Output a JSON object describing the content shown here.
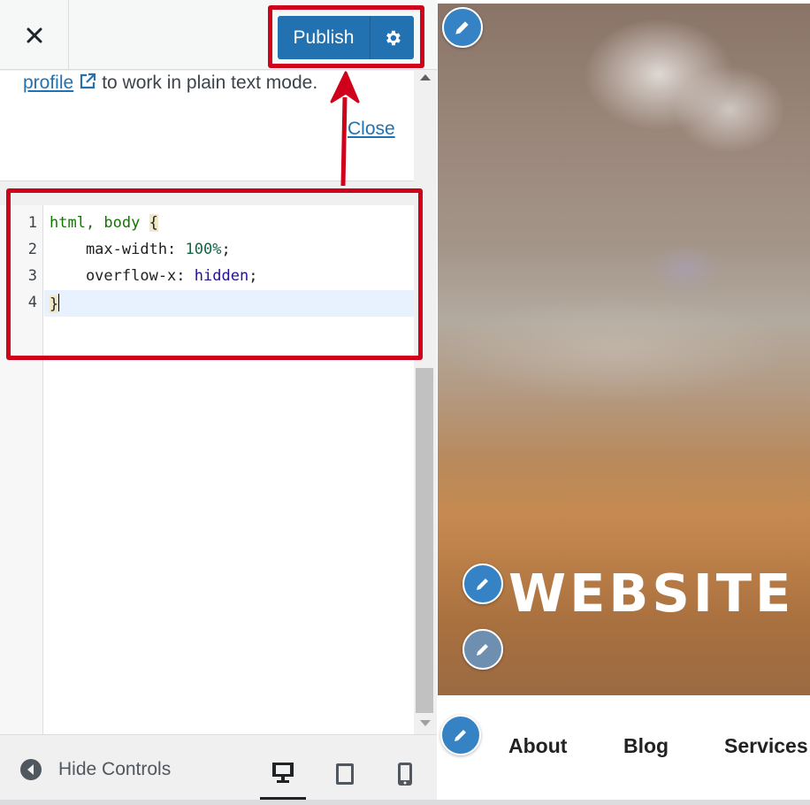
{
  "header": {
    "publish_label": "Publish"
  },
  "notice": {
    "link_text": "profile",
    "text_after": "to work in plain text mode.",
    "close_link": "Close"
  },
  "editor": {
    "line_numbers": [
      "1",
      "2",
      "3",
      "4"
    ],
    "line1": {
      "selector": "html, body",
      "brace": "{"
    },
    "line2": {
      "property": "    max-width: ",
      "value": "100%",
      "end": ";"
    },
    "line3": {
      "property": "    overflow-x: ",
      "value": "hidden",
      "end": ";"
    },
    "line4": {
      "brace": "}"
    }
  },
  "footer": {
    "hide_controls_label": "Hide Controls"
  },
  "preview": {
    "hero_title": "WEBSITE",
    "nav": [
      "About",
      "Blog",
      "Services"
    ]
  },
  "colors": {
    "accent": "#2271b1",
    "annotation": "#d0021b",
    "pencil": "#3582c4"
  }
}
